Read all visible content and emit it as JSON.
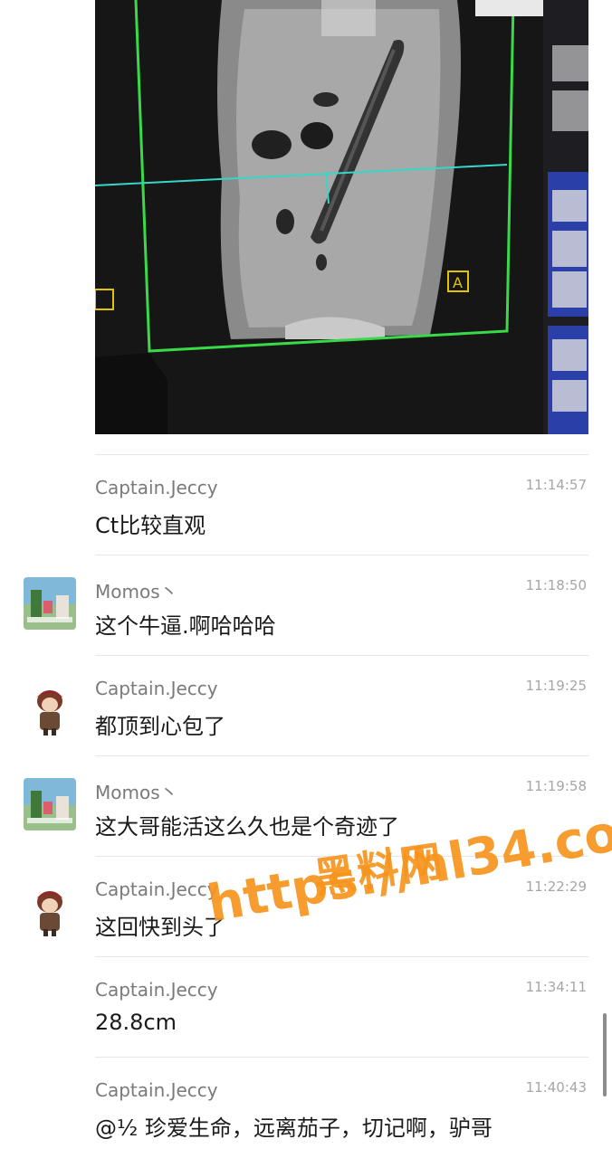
{
  "messages": [
    {
      "sender": "Captain.Jeccy",
      "time": "11:14:57",
      "text": "Ct比较直观",
      "avatar": "none"
    },
    {
      "sender": "Momos丶",
      "time": "11:18:50",
      "text": "这个牛逼.啊哈哈哈",
      "avatar": "landscape-avatar"
    },
    {
      "sender": "Captain.Jeccy",
      "time": "11:19:25",
      "text": "都顶到心包了",
      "avatar": "pirate-avatar"
    },
    {
      "sender": "Momos丶",
      "time": "11:19:58",
      "text": "这大哥能活这么久也是个奇迹了",
      "avatar": "landscape-avatar"
    },
    {
      "sender": "Captain.Jeccy",
      "time": "11:22:29",
      "text": "这回快到头了",
      "avatar": "pirate-avatar"
    },
    {
      "sender": "Captain.Jeccy",
      "time": "11:34:11",
      "text": "28.8cm",
      "avatar": "none"
    },
    {
      "sender": "Captain.Jeccy",
      "time": "11:40:43",
      "text": "@½ 珍爱生命，远离茄子，切记啊，驴哥",
      "avatar": "none"
    }
  ],
  "watermark": {
    "chinese": "黑料网",
    "url": "https://hl34.co"
  },
  "colors": {
    "watermark": "#f7941d",
    "sender": "#7a7a7a",
    "time": "#a6a6a6",
    "crosshair": "#36d6c8",
    "frame": "#39d94a"
  }
}
